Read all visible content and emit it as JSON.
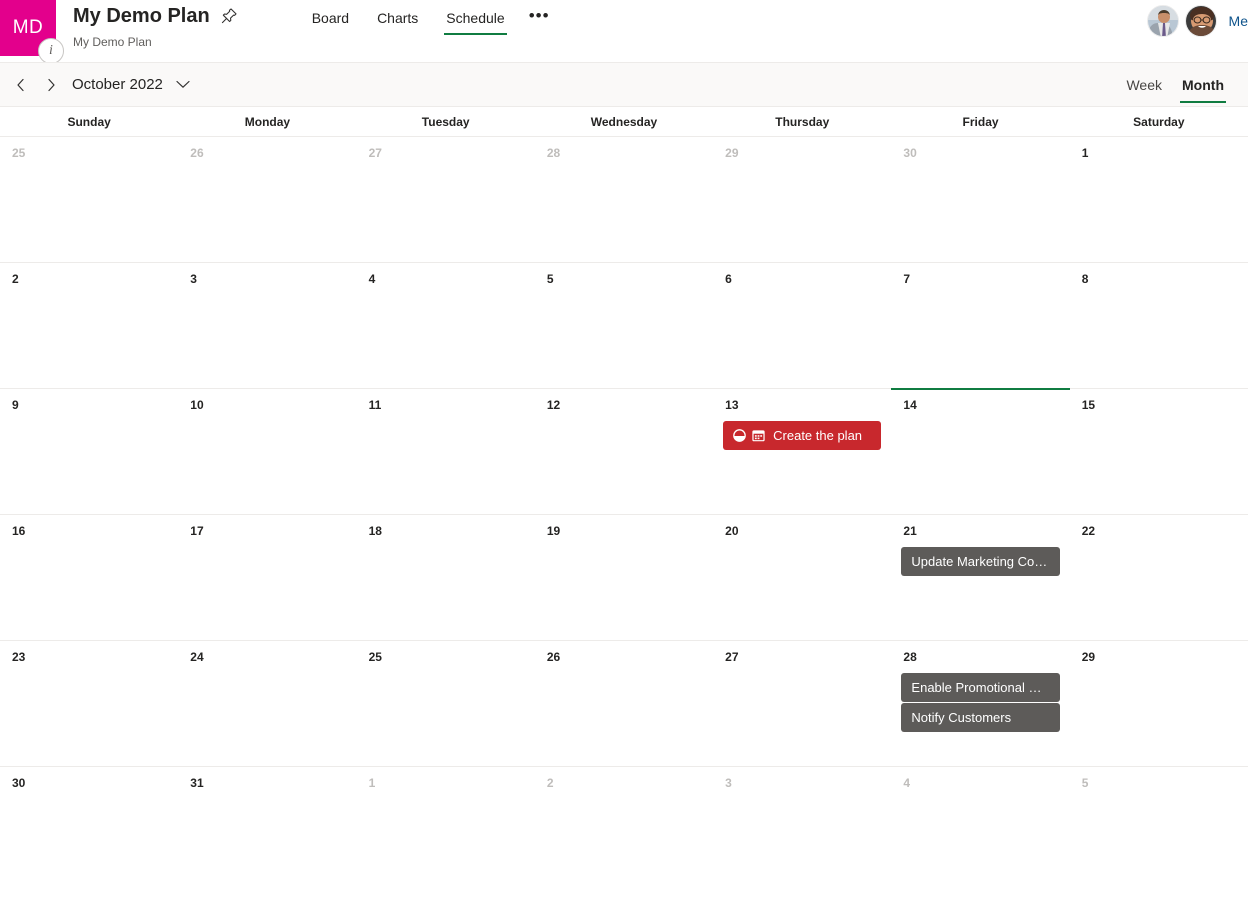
{
  "header": {
    "logo_initials": "MD",
    "info_badge": "i",
    "title": "My Demo Plan",
    "subtitle": "My Demo Plan",
    "pin_icon": "pin-icon",
    "tabs": [
      {
        "label": "Board",
        "active": false
      },
      {
        "label": "Charts",
        "active": false
      },
      {
        "label": "Schedule",
        "active": true
      }
    ],
    "more_label": "•••",
    "members_label": "Me",
    "accent_color": "#107c41",
    "logo_color": "#e3008c"
  },
  "toolbar": {
    "prev_label": "‹",
    "next_label": "›",
    "month_label": "October 2022",
    "views": [
      {
        "label": "Week",
        "active": false
      },
      {
        "label": "Month",
        "active": true
      }
    ]
  },
  "weekdays": [
    "Sunday",
    "Monday",
    "Tuesday",
    "Wednesday",
    "Thursday",
    "Friday",
    "Saturday"
  ],
  "colors": {
    "chip_red": "#c8282d",
    "chip_gray": "#5d5b59",
    "today_marker": "#107c41",
    "grid_line": "#edebe9",
    "toolbar_bg": "#faf9f8"
  },
  "weeks": [
    {
      "days": [
        {
          "num": "25",
          "other": true,
          "today": false,
          "events": []
        },
        {
          "num": "26",
          "other": true,
          "today": false,
          "events": []
        },
        {
          "num": "27",
          "other": true,
          "today": false,
          "events": []
        },
        {
          "num": "28",
          "other": true,
          "today": false,
          "events": []
        },
        {
          "num": "29",
          "other": true,
          "today": false,
          "events": []
        },
        {
          "num": "30",
          "other": true,
          "today": false,
          "events": []
        },
        {
          "num": "1",
          "other": false,
          "today": false,
          "events": []
        }
      ]
    },
    {
      "days": [
        {
          "num": "2",
          "other": false,
          "today": false,
          "events": []
        },
        {
          "num": "3",
          "other": false,
          "today": false,
          "events": []
        },
        {
          "num": "4",
          "other": false,
          "today": false,
          "events": []
        },
        {
          "num": "5",
          "other": false,
          "today": false,
          "events": []
        },
        {
          "num": "6",
          "other": false,
          "today": false,
          "events": []
        },
        {
          "num": "7",
          "other": false,
          "today": false,
          "events": []
        },
        {
          "num": "8",
          "other": false,
          "today": false,
          "events": []
        }
      ]
    },
    {
      "days": [
        {
          "num": "9",
          "other": false,
          "today": false,
          "events": []
        },
        {
          "num": "10",
          "other": false,
          "today": false,
          "events": []
        },
        {
          "num": "11",
          "other": false,
          "today": false,
          "events": []
        },
        {
          "num": "12",
          "other": false,
          "today": false,
          "events": []
        },
        {
          "num": "13",
          "other": false,
          "today": false,
          "events": [
            {
              "label": "Create the plan",
              "color": "red",
              "icons": [
                "progress-half-icon",
                "calendar-icon"
              ]
            }
          ]
        },
        {
          "num": "14",
          "other": false,
          "today": true,
          "events": []
        },
        {
          "num": "15",
          "other": false,
          "today": false,
          "events": []
        }
      ]
    },
    {
      "days": [
        {
          "num": "16",
          "other": false,
          "today": false,
          "events": []
        },
        {
          "num": "17",
          "other": false,
          "today": false,
          "events": []
        },
        {
          "num": "18",
          "other": false,
          "today": false,
          "events": []
        },
        {
          "num": "19",
          "other": false,
          "today": false,
          "events": []
        },
        {
          "num": "20",
          "other": false,
          "today": false,
          "events": []
        },
        {
          "num": "21",
          "other": false,
          "today": false,
          "events": [
            {
              "label": "Update Marketing Cont...",
              "color": "gray",
              "icons": []
            }
          ]
        },
        {
          "num": "22",
          "other": false,
          "today": false,
          "events": []
        }
      ]
    },
    {
      "days": [
        {
          "num": "23",
          "other": false,
          "today": false,
          "events": []
        },
        {
          "num": "24",
          "other": false,
          "today": false,
          "events": []
        },
        {
          "num": "25",
          "other": false,
          "today": false,
          "events": []
        },
        {
          "num": "26",
          "other": false,
          "today": false,
          "events": []
        },
        {
          "num": "27",
          "other": false,
          "today": false,
          "events": []
        },
        {
          "num": "28",
          "other": false,
          "today": false,
          "events": [
            {
              "label": "Enable Promotional Disc...",
              "color": "gray",
              "icons": []
            },
            {
              "label": "Notify Customers",
              "color": "gray",
              "icons": []
            }
          ]
        },
        {
          "num": "29",
          "other": false,
          "today": false,
          "events": []
        }
      ]
    },
    {
      "days": [
        {
          "num": "30",
          "other": false,
          "today": false,
          "events": []
        },
        {
          "num": "31",
          "other": false,
          "today": false,
          "events": []
        },
        {
          "num": "1",
          "other": true,
          "today": false,
          "events": []
        },
        {
          "num": "2",
          "other": true,
          "today": false,
          "events": []
        },
        {
          "num": "3",
          "other": true,
          "today": false,
          "events": []
        },
        {
          "num": "4",
          "other": true,
          "today": false,
          "events": []
        },
        {
          "num": "5",
          "other": true,
          "today": false,
          "events": []
        }
      ]
    }
  ]
}
